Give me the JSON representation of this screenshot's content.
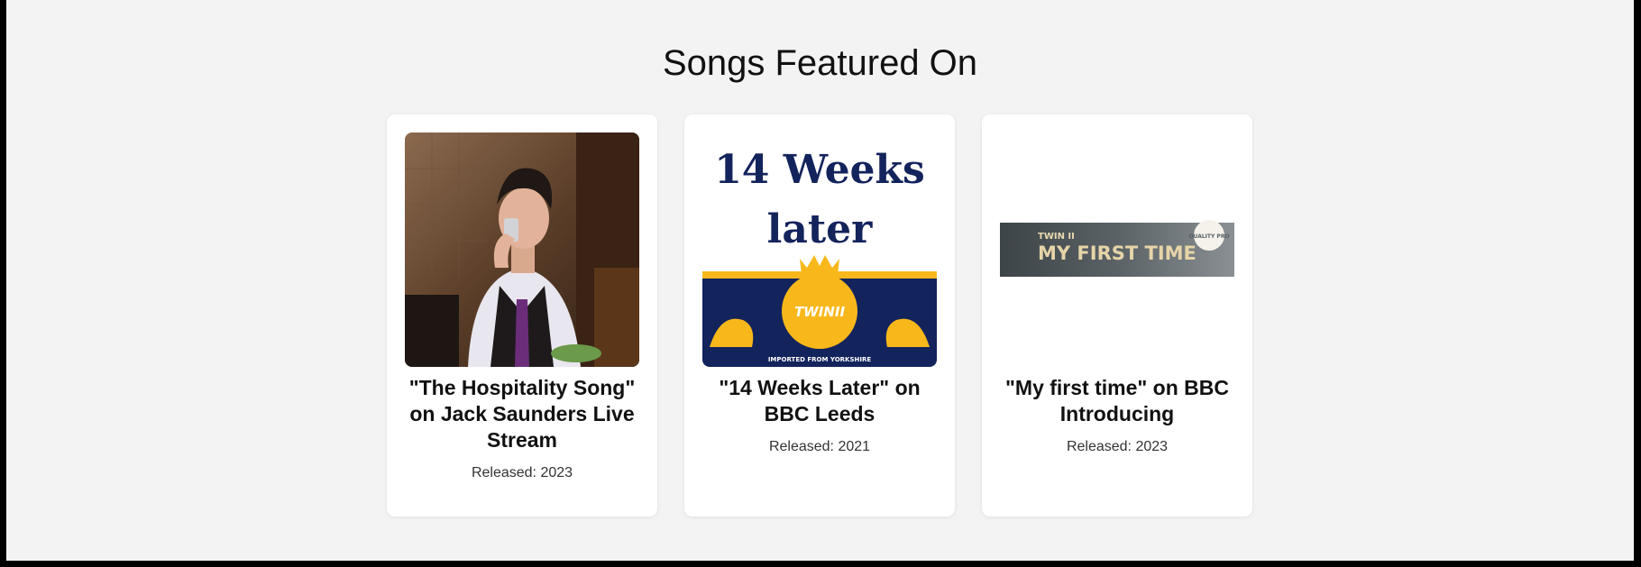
{
  "section": {
    "title": "Songs Featured On"
  },
  "cards": [
    {
      "title": "\"The Hospitality Song\" on Jack Saunders Live Stream",
      "released": "Released: 2023",
      "image": "man-drinking-photo"
    },
    {
      "title": "\"14 Weeks Later\" on BBC Leeds",
      "released": "Released: 2021",
      "image": "14-weeks-later-cover",
      "cover": {
        "line1": "14 Weeks",
        "line2": "later",
        "badge": "TWINII",
        "footer": "IMPORTED FROM YORKSHIRE"
      }
    },
    {
      "title": "\"My first time\" on BBC Introducing",
      "released": "Released: 2023",
      "image": "my-first-time-banner",
      "banner": {
        "small": "TWIN II",
        "big": "MY FIRST TIME",
        "seal": "QUALITY PRO"
      }
    }
  ],
  "colors": {
    "page_bg": "#f3f3f3",
    "card_bg": "#ffffff",
    "navy": "#13235c",
    "gold": "#f8b81b"
  }
}
